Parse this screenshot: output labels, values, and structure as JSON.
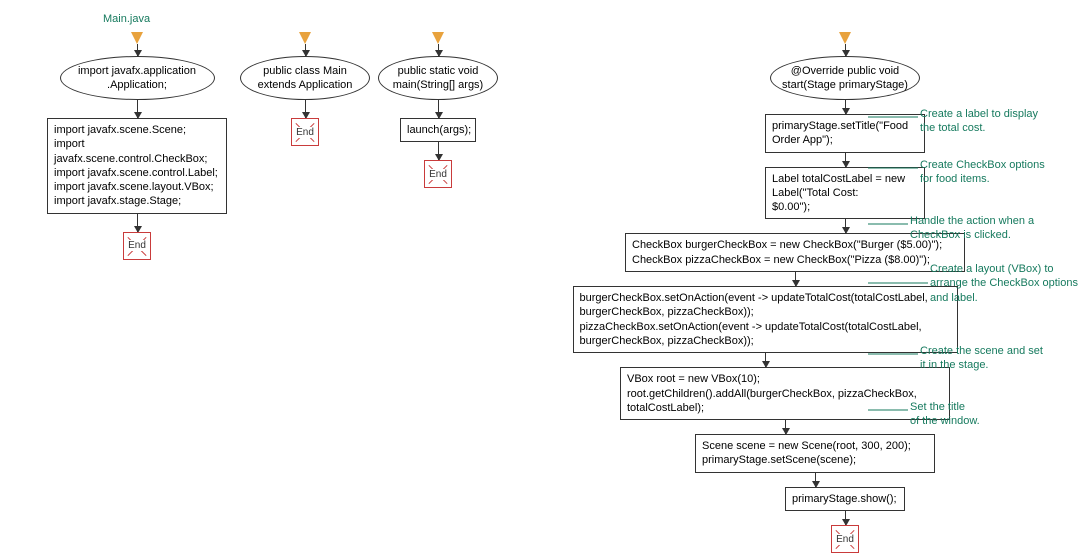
{
  "title": "Main.java",
  "col1": {
    "ellipse": "import javafx.application\n.Application;",
    "box": "import javafx.scene.Scene;\nimport javafx.scene.control.CheckBox;\nimport javafx.scene.control.Label;\nimport javafx.scene.layout.VBox;\nimport javafx.stage.Stage;",
    "end": "End"
  },
  "col2": {
    "ellipse": "public class Main\nextends Application",
    "end": "End"
  },
  "col3": {
    "ellipse": "public static void\nmain(String[] args)",
    "box": "launch(args);",
    "end": "End"
  },
  "col4": {
    "ellipse": "@Override public void\nstart(Stage primaryStage)",
    "box1": "primaryStage.setTitle(\"Food\nOrder App\");",
    "box2": "Label totalCostLabel = new\nLabel(\"Total Cost:\n$0.00\");",
    "box3": "CheckBox burgerCheckBox = new CheckBox(\"Burger ($5.00)\");\nCheckBox pizzaCheckBox = new CheckBox(\"Pizza ($8.00)\");",
    "box4": "burgerCheckBox.setOnAction(event -> updateTotalCost(totalCostLabel,\nburgerCheckBox, pizzaCheckBox));\npizzaCheckBox.setOnAction(event -> updateTotalCost(totalCostLabel,\nburgerCheckBox, pizzaCheckBox));",
    "box5": "VBox root = new VBox(10);\nroot.getChildren().addAll(burgerCheckBox, pizzaCheckBox,\ntotalCostLabel);",
    "box6": "Scene scene = new Scene(root, 300, 200);\nprimaryStage.setScene(scene);",
    "box7": "primaryStage.show();",
    "end": "End"
  },
  "annotations": {
    "a1": "Create a label to display\nthe total cost.",
    "a2": "Create CheckBox options\nfor food items.",
    "a3": "Handle the action when a\nCheckBox is clicked.",
    "a4": "Create a layout (VBox) to\narrange the CheckBox options\nand label.",
    "a5": "Create the scene and set\nit in the stage.",
    "a6": "Set the title\nof the window."
  }
}
